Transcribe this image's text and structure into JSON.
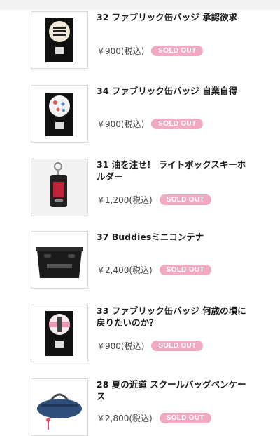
{
  "products": [
    {
      "title": "32 ファブリック缶バッジ 承認欲求",
      "price": "￥900(税込)",
      "status": "SOLD OUT",
      "image": "fabric-badge-approval"
    },
    {
      "title": "34 ファブリック缶バッジ 自業自得",
      "price": "￥900(税込)",
      "status": "SOLD OUT",
      "image": "fabric-badge-karma"
    },
    {
      "title": "31 油を注せ！ ライトボックスキーホルダー",
      "price": "￥1,200(税込)",
      "status": "SOLD OUT",
      "image": "lightbox-keychain"
    },
    {
      "title": "37 Buddiesミニコンテナ",
      "price": "￥2,400(税込)",
      "status": "SOLD OUT",
      "image": "mini-container"
    },
    {
      "title": "33 ファブリック缶バッジ 何歳の頃に戻りたいのか？",
      "price": "￥900(税込)",
      "status": "SOLD OUT",
      "image": "fabric-badge-age"
    },
    {
      "title": "28 夏の近道 スクールバッグペンケース",
      "price": "￥2,800(税込)",
      "status": "SOLD OUT",
      "image": "school-bag-pencase"
    }
  ],
  "colors": {
    "badge_bg": "#f2a9c3",
    "badge_text": "#ffffff",
    "thumb_border": "#d9d9d9"
  }
}
